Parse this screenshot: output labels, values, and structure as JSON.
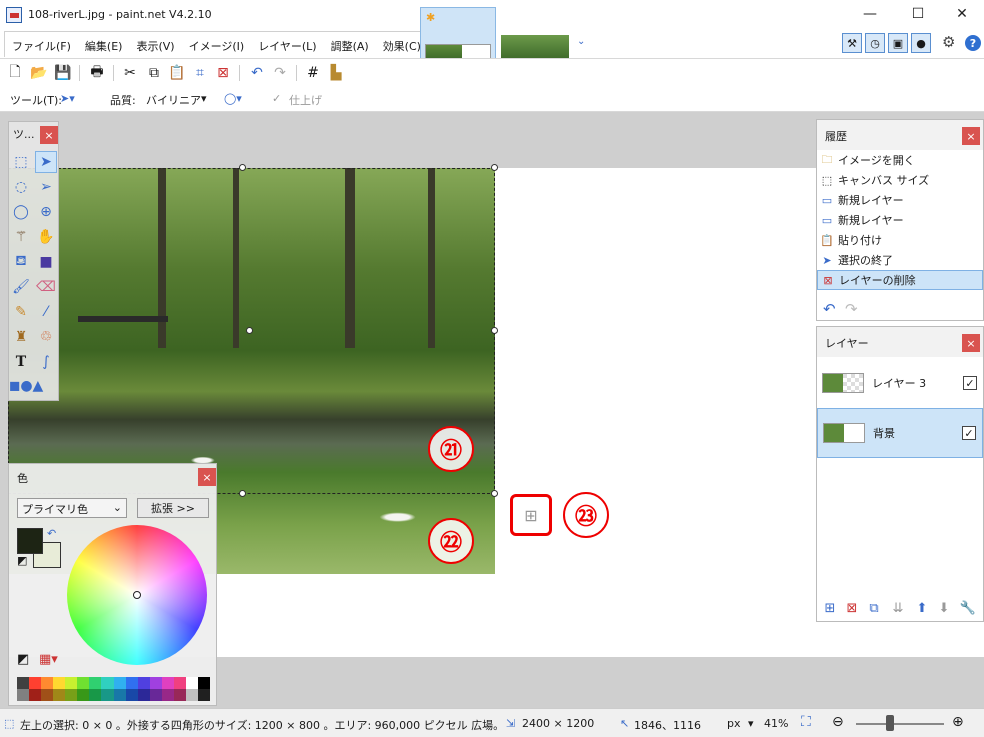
{
  "window": {
    "title": "108-riverL.jpg - paint.net V4.2.10",
    "minimize": "—",
    "maximize": "☐",
    "close": "✕"
  },
  "menu": [
    "ファイル(F)",
    "編集(E)",
    "表示(V)",
    "イメージ(I)",
    "レイヤー(L)",
    "調整(A)",
    "効果(C)"
  ],
  "toolbar_icons": [
    "new-icon",
    "open-icon",
    "save-icon",
    "print-icon",
    "cut-icon",
    "copy-icon",
    "paste-icon",
    "crop-icon",
    "deselect-icon",
    "undo-icon",
    "redo-icon",
    "grid-icon",
    "ruler-icon"
  ],
  "tool_settings": {
    "tool_label": "ツール(T):",
    "quality_label": "品質:",
    "quality_value": "バイリニア",
    "finish_label": "仕上げ"
  },
  "callouts": {
    "c21": "㉑",
    "c22": "㉒",
    "c23": "㉓"
  },
  "tools_panel": {
    "title": "ツ...",
    "close": "×",
    "tools": [
      "rect-select-icon",
      "move-selected-icon",
      "lasso-icon",
      "move-selection-icon",
      "ellipse-select-icon",
      "zoom-icon",
      "magic-wand-icon",
      "pan-icon",
      "paint-bucket-icon",
      "gradient-icon",
      "paintbrush-icon",
      "eraser-icon",
      "pencil-icon",
      "color-picker-icon",
      "clone-stamp-icon",
      "recolor-icon",
      "text-icon",
      "line-curve-icon",
      "shapes-icon"
    ]
  },
  "colors_panel": {
    "title": "色",
    "close": "×",
    "select_value": "プライマリ色",
    "expand_label": "拡張 >>",
    "primary_color": "#1d2414",
    "secondary_color": "#e8ecd8",
    "palette": [
      "#404040",
      "#ff4030",
      "#ff8a30",
      "#ffd830",
      "#c8f030",
      "#70e030",
      "#30d070",
      "#30d0c0",
      "#30b0f0",
      "#3070f0",
      "#5040e0",
      "#a040e0",
      "#e040c0",
      "#f04080",
      "#ffffff",
      "#000000",
      "#808080",
      "#a02018",
      "#a05018",
      "#a08818",
      "#78a018",
      "#389818",
      "#189848",
      "#189888",
      "#1878a8",
      "#1848a8",
      "#2c2898",
      "#682898",
      "#982888",
      "#982858",
      "#c0c0c0",
      "#202020"
    ]
  },
  "history_panel": {
    "title": "履歴",
    "close": "×",
    "items": [
      {
        "label": "イメージを開く",
        "icon": "folder-icon"
      },
      {
        "label": "キャンバス サイズ",
        "icon": "canvas-size-icon"
      },
      {
        "label": "新規レイヤー",
        "icon": "new-layer-icon"
      },
      {
        "label": "新規レイヤー",
        "icon": "new-layer-icon"
      },
      {
        "label": "貼り付け",
        "icon": "paste-icon"
      },
      {
        "label": "選択の終了",
        "icon": "move-selection-icon"
      },
      {
        "label": "レイヤーの削除",
        "icon": "delete-layer-icon"
      }
    ]
  },
  "layers_panel": {
    "title": "レイヤー",
    "close": "×",
    "layers": [
      {
        "name": "レイヤー 3",
        "checked": "✓"
      },
      {
        "name": "背景",
        "checked": "✓"
      }
    ]
  },
  "status": {
    "selection_info": "左上の選択: 0 × 0 。外接する四角形のサイズ: 1200 × 800 。エリア: 960,000 ピクセル 広場。",
    "image_size": "2400 × 1200",
    "cursor_pos": "1846、1116",
    "units": "px",
    "zoom": "41%"
  }
}
